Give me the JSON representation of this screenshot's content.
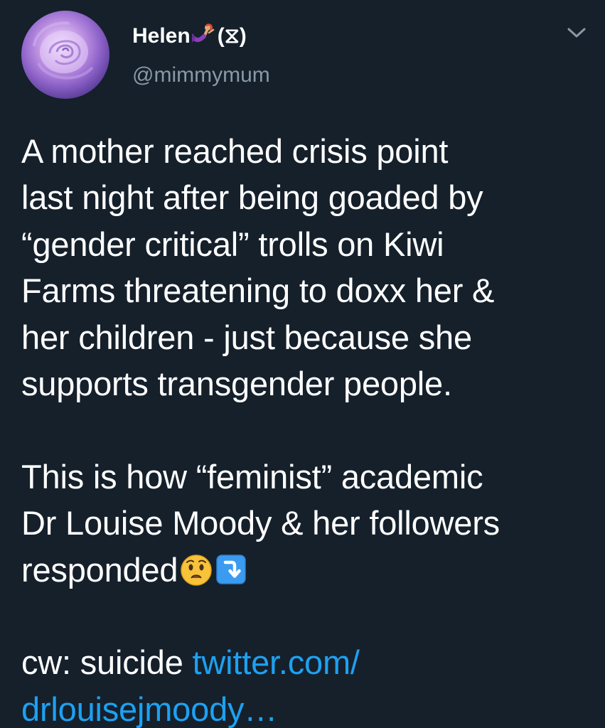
{
  "tweet": {
    "author_name": "Helen",
    "author_suffix": "(⧖)",
    "handle": "@mimmymum",
    "paragraph1": [
      "A mother reached crisis point",
      "last night after being goaded by",
      "“gender critical” trolls on Kiwi",
      "Farms threatening to doxx her &",
      "her children - just because she",
      "supports transgender people."
    ],
    "paragraph2": [
      "This is how “feminist” academic",
      "Dr Louise Moody & her followers"
    ],
    "paragraph2_last": "responded",
    "cw_text": "cw: suicide ",
    "link_part1": "twitter.com/",
    "link_part2": "drlouisejmoody…"
  },
  "icons": {
    "avatar": "rose-avatar",
    "name_emoji": "mermaid-icon",
    "menu": "chevron-down-icon",
    "emoji_1": "worried-face-icon",
    "emoji_2": "arrow-curving-down-icon"
  },
  "colors": {
    "background": "#15202b",
    "text": "#ffffff",
    "secondary": "#8899a6",
    "link": "#1da1f2"
  }
}
